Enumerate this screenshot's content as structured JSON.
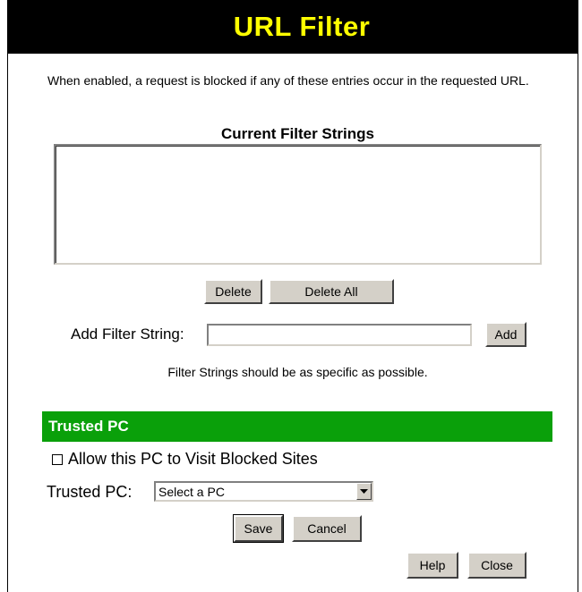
{
  "page": {
    "title": "URL Filter"
  },
  "filter": {
    "intro": "When enabled, a request is blocked if any of these entries occur in the requested URL.",
    "list_heading": "Current Filter Strings",
    "entries": [],
    "delete_label": "Delete",
    "delete_all_label": "Delete All",
    "add_label": "Add Filter String:",
    "add_value": "",
    "add_button_label": "Add",
    "hint": "Filter Strings should be as specific as possible."
  },
  "trusted": {
    "heading": "Trusted PC",
    "allow_label": "Allow this PC to Visit Blocked Sites",
    "allow_checked": false,
    "pc_label": "Trusted PC:",
    "pc_selected": "Select a PC"
  },
  "actions": {
    "save_label": "Save",
    "cancel_label": "Cancel",
    "help_label": "Help",
    "close_label": "Close"
  },
  "colors": {
    "title_bg": "#000000",
    "title_text": "#ffff00",
    "section_bar_bg": "#0aa00a",
    "section_bar_text": "#ffffff",
    "button_face": "#d4d0c8"
  }
}
